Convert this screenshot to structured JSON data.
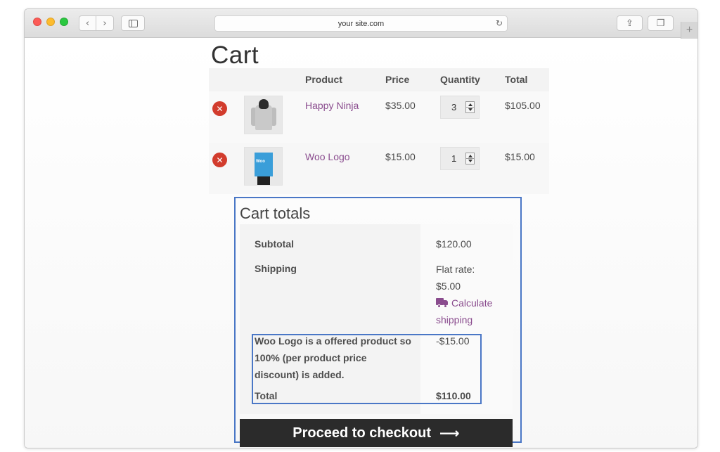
{
  "browser": {
    "url": "your site.com"
  },
  "cart": {
    "title": "Cart",
    "columns": {
      "product": "Product",
      "price": "Price",
      "quantity": "Quantity",
      "total": "Total"
    },
    "items": [
      {
        "name": "Happy Ninja",
        "price": "$35.00",
        "quantity": "3",
        "total": "$105.00",
        "thumbnail_icon": "hoodie-image"
      },
      {
        "name": "Woo Logo",
        "price": "$15.00",
        "quantity": "1",
        "total": "$15.00",
        "thumbnail_icon": "poster-image",
        "poster_text": "Woo"
      }
    ]
  },
  "totals": {
    "title": "Cart totals",
    "subtotal_label": "Subtotal",
    "subtotal_value": "$120.00",
    "shipping_label": "Shipping",
    "shipping_rate_line1": "Flat rate:",
    "shipping_rate_line2": "$5.00",
    "calculate_line1": "Calculate",
    "calculate_line2": "shipping",
    "discount_line1": "Woo Logo is a offered product so",
    "discount_line2": "100% (per product price",
    "discount_line3": "discount) is added.",
    "discount_value": "-$15.00",
    "total_label": "Total",
    "total_value": "$110.00"
  },
  "checkout": {
    "label": "Proceed to checkout",
    "arrow": "⟶"
  },
  "colors": {
    "link": "#8a4c8e",
    "remove": "#d23c2d",
    "highlight": "#4a77c6",
    "button": "#2b2b2b"
  }
}
